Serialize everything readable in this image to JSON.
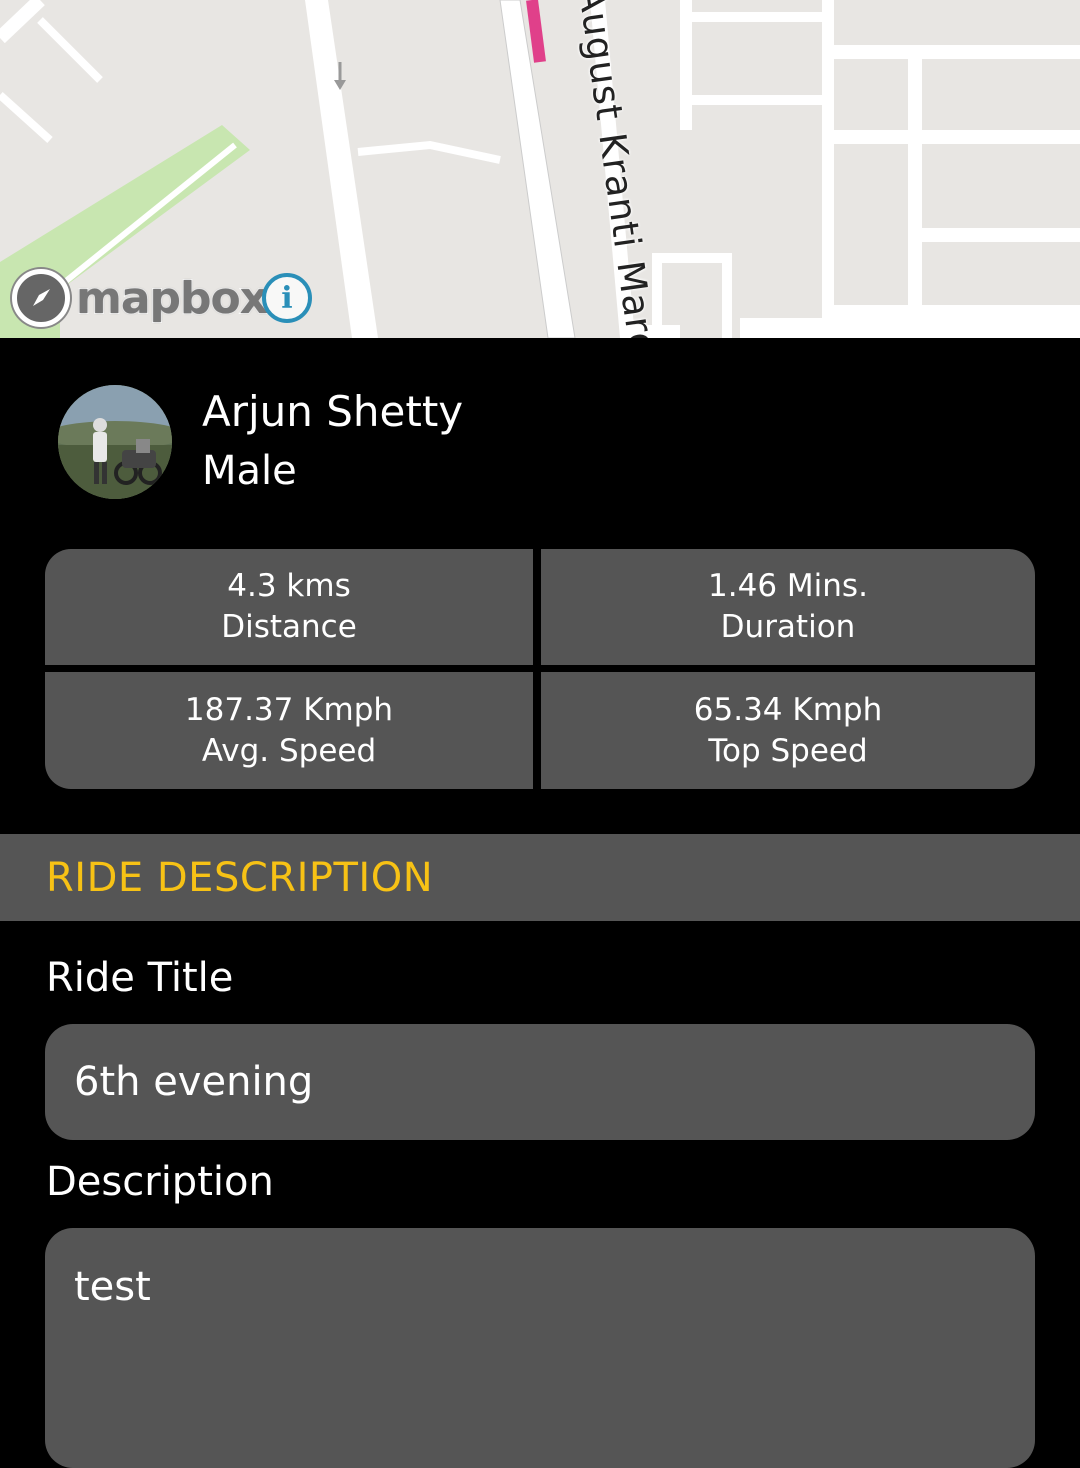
{
  "map": {
    "street_name": "August Kranti Marg",
    "attribution": "mapbox",
    "info_symbol": "i",
    "route_color": "#e0408a",
    "park_color": "#c8e6b0",
    "icons": [
      "mapbox-logo-icon",
      "info-icon",
      "compass-icon"
    ]
  },
  "rider": {
    "name": "Arjun Shetty",
    "gender": "Male"
  },
  "stats": {
    "distance": {
      "value": "4.3 kms",
      "label": "Distance"
    },
    "duration": {
      "value": "1.46 Mins.",
      "label": "Duration"
    },
    "avg_speed": {
      "value": "187.37 Kmph",
      "label": "Avg. Speed"
    },
    "top_speed": {
      "value": "65.34 Kmph",
      "label": "Top Speed"
    }
  },
  "section": {
    "title": "RIDE DESCRIPTION",
    "accent_color": "#f7c215"
  },
  "form": {
    "title_label": "Ride Title",
    "title_value": "6th evening",
    "description_label": "Description",
    "description_value": "test"
  }
}
